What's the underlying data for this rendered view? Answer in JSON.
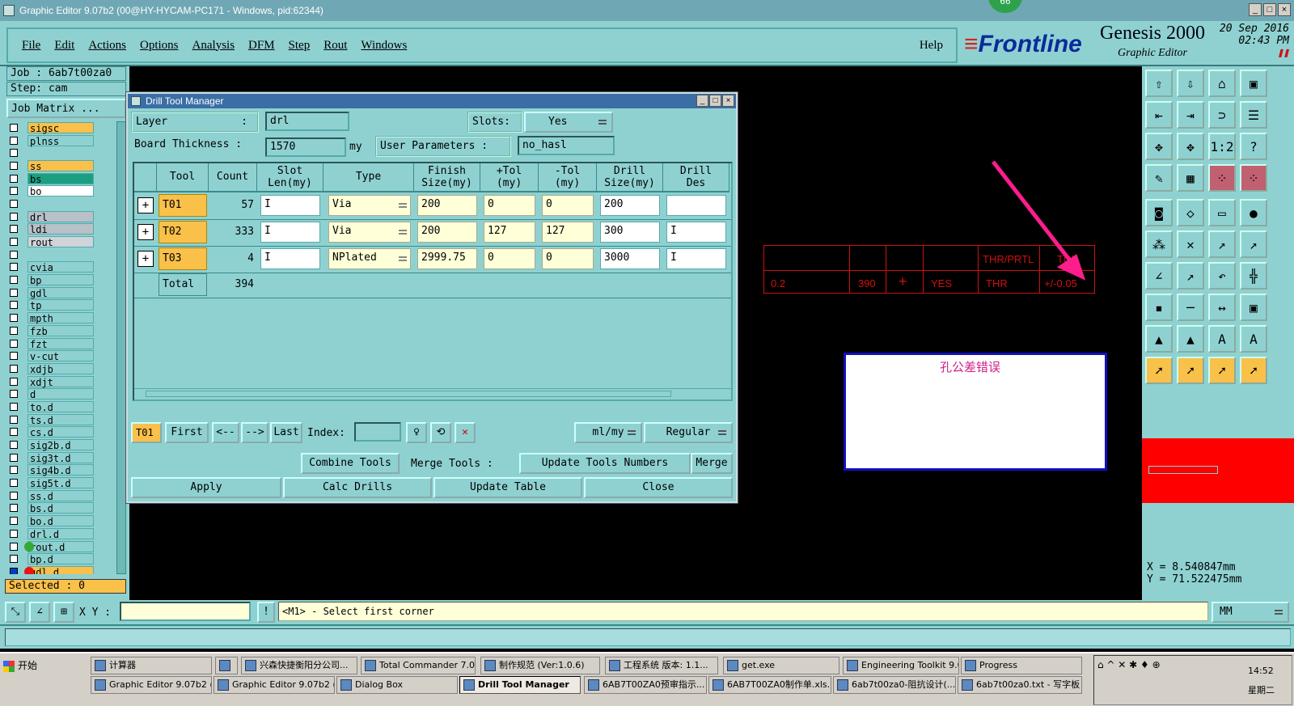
{
  "window": {
    "title": "Graphic Editor 9.07b2 (00@HY-HYCAM-PC171 - Windows, pid:62344)",
    "badge": "66"
  },
  "menu": {
    "items": [
      "File",
      "Edit",
      "Actions",
      "Options",
      "Analysis",
      "DFM",
      "Step",
      "Rout",
      "Windows"
    ],
    "help": "Help"
  },
  "brand": {
    "logo": "Frontline",
    "product": "Genesis 2000",
    "subtitle": "Graphic Editor",
    "date": "20 Sep 2016",
    "time": "02:43 PM"
  },
  "left": {
    "job": "Job : 6ab7t00za0",
    "step": "Step: cam",
    "job_matrix": "Job Matrix ...",
    "layers": [
      {
        "name": "sigsc",
        "color": "#f9c04a"
      },
      {
        "name": "plnss",
        "color": "#8fd1d1"
      },
      {
        "name": "",
        "color": "#8fd1d1"
      },
      {
        "name": "ss",
        "color": "#f9c04a"
      },
      {
        "name": "bs",
        "color": "#1aa080"
      },
      {
        "name": "bo",
        "color": "#ffffff"
      },
      {
        "name": "",
        "color": "#8fd1d1"
      },
      {
        "name": "drl",
        "color": "#b8c0c8"
      },
      {
        "name": "ldi",
        "color": "#b8c0c8"
      },
      {
        "name": "rout",
        "color": "#d0d4d8"
      },
      {
        "name": "",
        "color": "#8fd1d1"
      },
      {
        "name": "cvia",
        "color": "#8fd1d1"
      },
      {
        "name": "bp",
        "color": "#8fd1d1"
      },
      {
        "name": "gdl",
        "color": "#8fd1d1"
      },
      {
        "name": "tp",
        "color": "#8fd1d1"
      },
      {
        "name": "mpth",
        "color": "#8fd1d1"
      },
      {
        "name": "fzb",
        "color": "#8fd1d1"
      },
      {
        "name": "fzt",
        "color": "#8fd1d1"
      },
      {
        "name": "v-cut",
        "color": "#8fd1d1"
      },
      {
        "name": "xdjb",
        "color": "#8fd1d1"
      },
      {
        "name": "xdjt",
        "color": "#8fd1d1"
      },
      {
        "name": "d",
        "color": "#8fd1d1"
      },
      {
        "name": "to.d",
        "color": "#8fd1d1"
      },
      {
        "name": "ts.d",
        "color": "#8fd1d1"
      },
      {
        "name": "cs.d",
        "color": "#8fd1d1"
      },
      {
        "name": "sig2b.d",
        "color": "#8fd1d1"
      },
      {
        "name": "sig3t.d",
        "color": "#8fd1d1"
      },
      {
        "name": "sig4b.d",
        "color": "#8fd1d1"
      },
      {
        "name": "sig5t.d",
        "color": "#8fd1d1"
      },
      {
        "name": "ss.d",
        "color": "#8fd1d1"
      },
      {
        "name": "bs.d",
        "color": "#8fd1d1"
      },
      {
        "name": "bo.d",
        "color": "#8fd1d1"
      },
      {
        "name": "drl.d",
        "color": "#8fd1d1"
      },
      {
        "name": "rout.d",
        "color": "#8fd1d1"
      },
      {
        "name": "bp.d",
        "color": "#8fd1d1"
      },
      {
        "name": "gdl.d",
        "color": "#f9c04a"
      },
      {
        "name": "tp.d",
        "color": "#8fd1d1"
      }
    ],
    "selected": "Selected : 0"
  },
  "dialog": {
    "title": "Drill Tool Manager",
    "layer_label": "Layer",
    "layer_colon": ":",
    "layer_value": "drl",
    "slots_label": "Slots:",
    "slots_value": "Yes",
    "board_label": "Board Thickness :",
    "board_value": "1570",
    "board_unit": "my",
    "user_params_label": "User Parameters :",
    "user_params_value": "no_hasl",
    "headers": [
      "Tool",
      "Count",
      "Slot\nLen(my)",
      "Type",
      "Finish\nSize(my)",
      "+Tol\n(my)",
      "-Tol\n(my)",
      "Drill\nSize(my)",
      "Drill\nDes"
    ],
    "rows": [
      {
        "tool": "T01",
        "count": "57",
        "type": "Via",
        "finish": "200",
        "ptol": "0",
        "mtol": "0",
        "drill": "200"
      },
      {
        "tool": "T02",
        "count": "333",
        "type": "Via",
        "finish": "200",
        "ptol": "127",
        "mtol": "127",
        "drill": "300"
      },
      {
        "tool": "T03",
        "count": "4",
        "type": "NPlated",
        "finish": "2999.75",
        "ptol": "0",
        "mtol": "0",
        "drill": "3000"
      }
    ],
    "total_label": "Total",
    "total_count": "394",
    "nav": {
      "current": "T01",
      "first": "First",
      "prev": "<--",
      "next": "-->",
      "last": "Last",
      "index_label": "Index:",
      "units": "ml/my",
      "mode": "Regular"
    },
    "buttons": {
      "combine": "Combine Tools",
      "merge_tools": "Merge Tools :",
      "update_numbers": "Update Tools Numbers",
      "merge": "Merge",
      "apply": "Apply",
      "calc": "Calc Drills",
      "update_table": "Update Table",
      "close": "Close"
    }
  },
  "graphic": {
    "table_header": [
      "",
      "",
      "",
      "",
      "THR/PRTL",
      "TOL"
    ],
    "table_row": [
      "0.2",
      "390",
      "+",
      "YES",
      "THR",
      "+/-0.05"
    ],
    "note": "孔公差错误",
    "annotation_color": "#ff1c8d"
  },
  "right": {
    "x": "X =  8.540847mm",
    "y": "Y = 71.522475mm"
  },
  "command": {
    "xy_label": "X Y :",
    "prompt": "<M1> - Select first corner",
    "units": "MM"
  },
  "taskbar": {
    "start": "开始",
    "row1": [
      "计算器",
      "",
      "兴森快捷衡阳分公司...",
      "Total Commander 7.0 ...",
      "制作规范 (Ver:1.0.6)",
      "工程系统 版本: 1.1...",
      "get.exe",
      "Engineering Toolkit 9.0...",
      "Progress"
    ],
    "row2": [
      "Graphic Editor 9.07b2 (...",
      "Graphic Editor 9.07b2 (...",
      "Dialog Box",
      "Drill Tool Manager",
      "6AB7T00ZA0预审指示...",
      "6AB7T00ZA0制作单.xls...",
      "6ab7t00za0-阻抗设计(...",
      "6ab7t00za0.txt - 写字板"
    ],
    "clock": "14:52",
    "weekday": "星期二"
  }
}
